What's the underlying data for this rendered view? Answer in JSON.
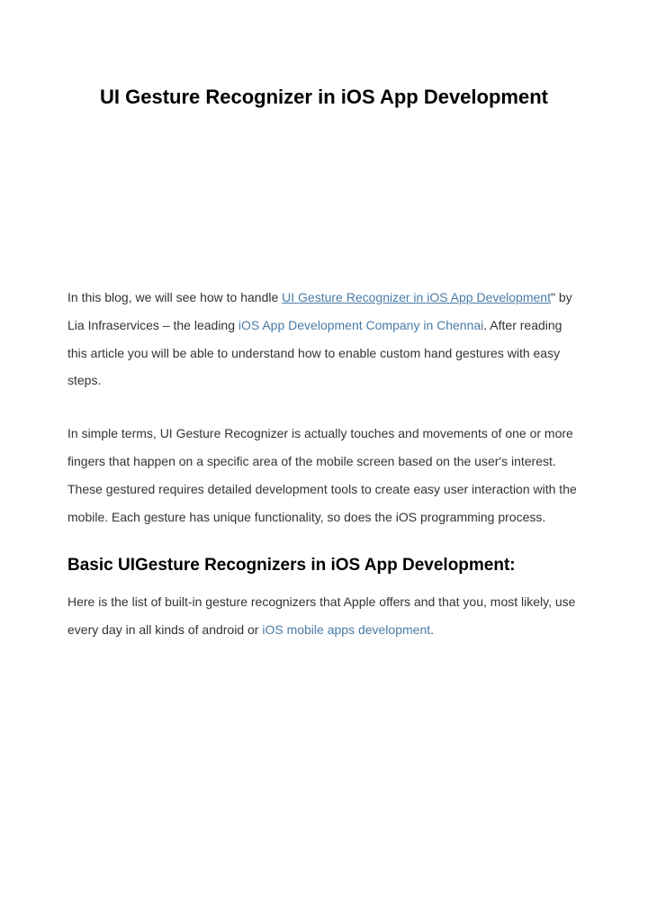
{
  "title": "UI Gesture Recognizer in iOS App Development",
  "intro": {
    "prefix": "In this blog, we will see how to handle ",
    "link1": "UI Gesture Recognizer in iOS App Development",
    "mid1": "\" by Lia Infraservices – the leading ",
    "link2": "iOS App Development Company in Chennai",
    "suffix": ". After reading this article you will be able to understand how to enable custom hand gestures with easy steps."
  },
  "paragraph2": "In simple terms, UI Gesture Recognizer is actually touches and movements of one or more fingers that happen on a specific area of the mobile screen based on the user's interest. These gestured requires detailed development tools to create easy user interaction with the mobile. Each gesture has unique functionality, so does the iOS programming process.",
  "subheading": "Basic UIGesture Recognizers in iOS App Development:",
  "list_intro": {
    "prefix": "Here is the list of built-in gesture recognizers that Apple offers and that you, most likely, use every day in all kinds of android or ",
    "link": "iOS mobile apps development",
    "suffix": "."
  }
}
